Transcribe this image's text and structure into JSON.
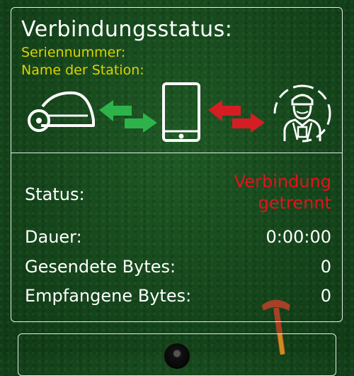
{
  "header": {
    "title": "Verbindungsstatus:",
    "serial_label": "Seriennummer:",
    "station_label": "Name der Station:"
  },
  "icons": {
    "mower": "robot-mower-icon",
    "arrows_left": "green-bidirectional-arrows-icon",
    "phone": "smartphone-icon",
    "arrows_right": "red-bidirectional-arrows-icon",
    "technician": "service-technician-icon"
  },
  "status": {
    "label": "Status:",
    "value_line1": "Verbindung",
    "value_line2": "getrennt",
    "color": "#e3131b"
  },
  "rows": [
    {
      "label": "Dauer:",
      "value": "0:00:00"
    },
    {
      "label": "Gesendete Bytes:",
      "value": "0"
    },
    {
      "label": "Empfangene Bytes:",
      "value": "0"
    }
  ],
  "colors": {
    "accent_yellow": "#ddd200",
    "arrow_green": "#2db34a",
    "arrow_red": "#d41e24",
    "panel_border": "#e8efe9"
  }
}
